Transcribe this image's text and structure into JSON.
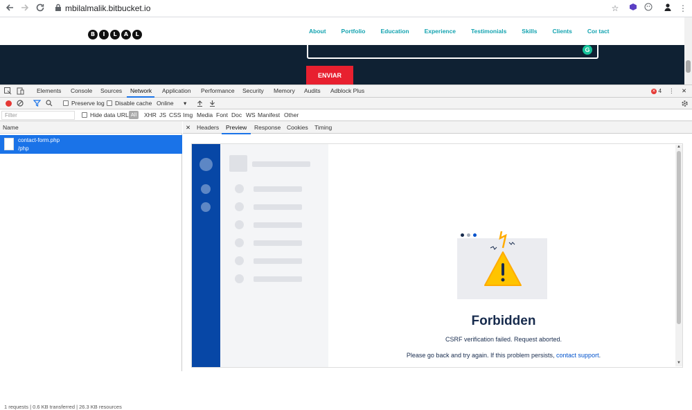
{
  "browser": {
    "url": "mbilalmalik.bitbucket.io",
    "back_icon": "arrow-left",
    "forward_icon": "arrow-right",
    "reload_icon": "reload",
    "secure_icon": "lock",
    "star_icon": "star"
  },
  "site": {
    "logo_letters": [
      "B",
      "I",
      "L",
      "A",
      "L"
    ],
    "nav": [
      "About",
      "Portfolio",
      "Education",
      "Experience",
      "Testimonials",
      "Skills",
      "Clients",
      "Contact"
    ],
    "submit_label": "ENVIAR",
    "accent_color": "#13a3b0",
    "button_color": "#e8202f"
  },
  "devtools": {
    "tabs": [
      "Elements",
      "Console",
      "Sources",
      "Network",
      "Application",
      "Performance",
      "Security",
      "Memory",
      "Audits",
      "Adblock Plus"
    ],
    "active_tab": "Network",
    "error_count": "4",
    "toolbar": {
      "preserve_log": "Preserve log",
      "disable_cache": "Disable cache",
      "throttling": "Online"
    },
    "filter": {
      "placeholder": "Filter",
      "hide_data_urls": "Hide data URLs",
      "all": "All",
      "types": [
        "XHR",
        "JS",
        "CSS",
        "Img",
        "Media",
        "Font",
        "Doc",
        "WS",
        "Manifest",
        "Other"
      ]
    },
    "requests": {
      "column_name": "Name",
      "items": [
        {
          "name": "contact-form.php",
          "path": "/php"
        }
      ],
      "status_bar": "1 requests | 0.6 KB transferred | 26.3 KB resources"
    },
    "detail_tabs": [
      "Headers",
      "Preview",
      "Response",
      "Cookies",
      "Timing"
    ],
    "active_detail_tab": "Preview",
    "preview": {
      "title": "Forbidden",
      "message": "CSRF verification failed. Request aborted.",
      "advice_text": "Please go back and try again. If this problem persists,",
      "advice_link": "contact support",
      "advice_end": "."
    }
  }
}
